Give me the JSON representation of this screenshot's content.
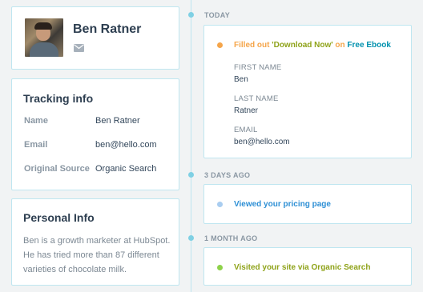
{
  "profile": {
    "name": "Ben Ratner",
    "mail_icon": "envelope-icon"
  },
  "tracking": {
    "title": "Tracking info",
    "rows": [
      {
        "label": "Name",
        "value": "Ben Ratner"
      },
      {
        "label": "Email",
        "value": "ben@hello.com"
      },
      {
        "label": "Original Source",
        "value": "Organic Search"
      }
    ]
  },
  "personal": {
    "title": "Personal Info",
    "text": "Ben is a growth marketer at HubSpot. He has tried more than 87 different varieties of chocolate milk."
  },
  "timeline": {
    "groups": [
      {
        "heading": "TODAY",
        "event": {
          "dot_color": "#f5a54a",
          "prefix": "Filled out ",
          "form_name": "'Download Now'",
          "middle": " on ",
          "page_name": "Free Ebook",
          "fields": [
            {
              "label": "FIRST NAME",
              "value": "Ben"
            },
            {
              "label": "LAST NAME",
              "value": "Ratner"
            },
            {
              "label": "EMAIL",
              "value": "ben@hello.com"
            }
          ]
        }
      },
      {
        "heading": "3 DAYS AGO",
        "event": {
          "dot_color": "#a9cdf0",
          "text": "Viewed your pricing page"
        }
      },
      {
        "heading": "1 MONTH AGO",
        "event": {
          "dot_color": "#8ed24a",
          "text": "Visited your site via Organic Search"
        }
      }
    ]
  },
  "colors": {
    "accent_border": "#bfe6f0",
    "orange": "#f5a54a",
    "link_blue": "#0091ae",
    "pricing_blue": "#2d8fd5",
    "olive": "#8fa31a"
  }
}
